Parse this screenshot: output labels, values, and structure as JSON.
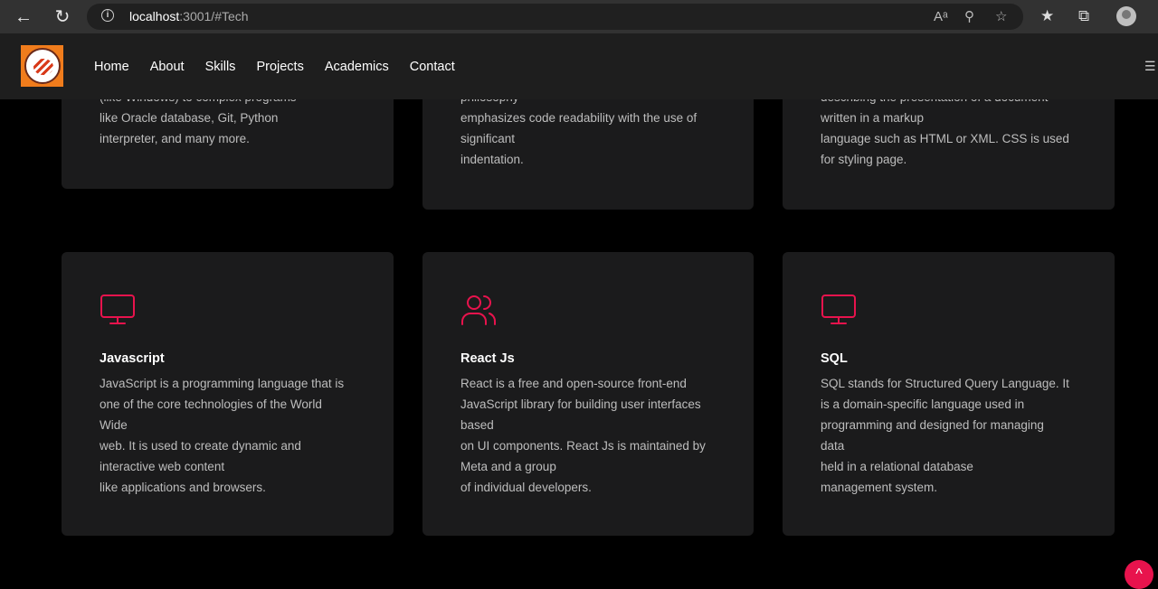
{
  "browser": {
    "url_host": "localhost",
    "url_path": ":3001/#Tech",
    "icons": [
      "back-icon",
      "refresh-icon",
      "info-icon",
      "read-aloud-icon",
      "zoom-out-icon",
      "favorite-add-icon",
      "favorites-icon",
      "collections-icon",
      "profile-icon"
    ]
  },
  "header": {
    "nav": [
      "Home",
      "About",
      "Skills",
      "Projects",
      "Academics",
      "Contact"
    ],
    "menu_icon": "☰"
  },
  "cards_top": [
    {
      "text": "(like Windows) to complex programs\nlike Oracle database, Git, Python\ninterpreter, and many more."
    },
    {
      "text": "philosophy\nemphasizes code readability with the use of\nsignificant\nindentation."
    },
    {
      "text": "describing the presentation of a document\nwritten in a markup\nlanguage such as HTML or XML. CSS is used\nfor styling page."
    }
  ],
  "cards": [
    {
      "title": "Javascript",
      "icon": "monitor-icon",
      "text": "JavaScript is a programming language that is\none of the core technologies of the World\nWide\nweb. It is used to create dynamic and\ninteractive web content\nlike applications and browsers."
    },
    {
      "title": "React Js",
      "icon": "users-icon",
      "text": "React is a free and open-source front-end\nJavaScript library for building user interfaces\nbased\non UI components. React Js is maintained by\nMeta and a group\nof individual developers."
    },
    {
      "title": "SQL",
      "icon": "monitor-icon",
      "text": "SQL stands for Structured Query Language. It\nis a domain-specific language used in\nprogramming and designed for managing\ndata\nheld in a relational database\nmanagement system."
    }
  ],
  "colors": {
    "accent": "#e8134d",
    "card_bg": "#1b1b1c"
  },
  "scroll_top": "^"
}
